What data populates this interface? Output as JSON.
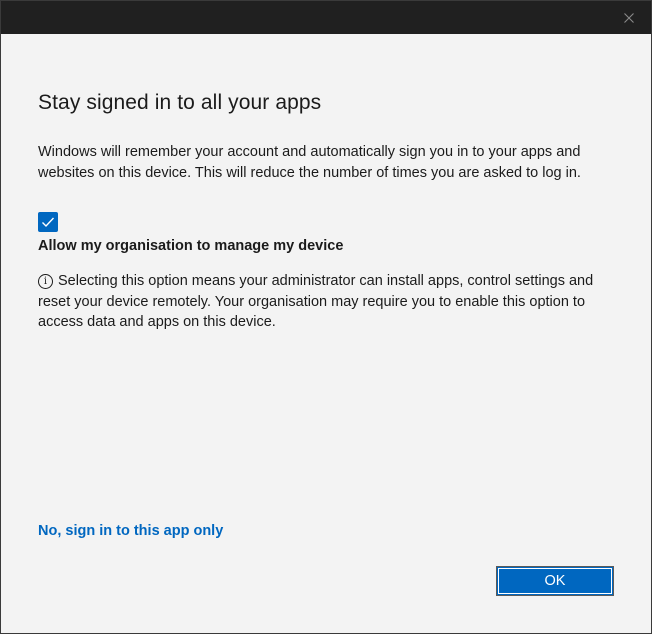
{
  "window": {
    "close_glyph": "✕"
  },
  "dialog": {
    "title": "Stay signed in to all your apps",
    "description": "Windows will remember your account and automatically sign you in to your apps and websites on this device. This will reduce the number of times you are asked to log in.",
    "checkbox": {
      "checked": true,
      "label": "Allow my organisation to manage my device"
    },
    "info_text": "Selecting this option means your administrator can install apps, control settings and reset your device remotely. Your organisation may require you to enable this option to access data and apps on this device.",
    "info_icon": "i",
    "secondary_link": "No, sign in to this app only",
    "ok_label": "OK"
  },
  "colors": {
    "accent": "#0067c0",
    "titlebar": "#202020",
    "background": "#f3f3f3"
  },
  "icons": {
    "close": "close-icon",
    "checkmark": "checkmark-icon",
    "info": "info-icon"
  }
}
